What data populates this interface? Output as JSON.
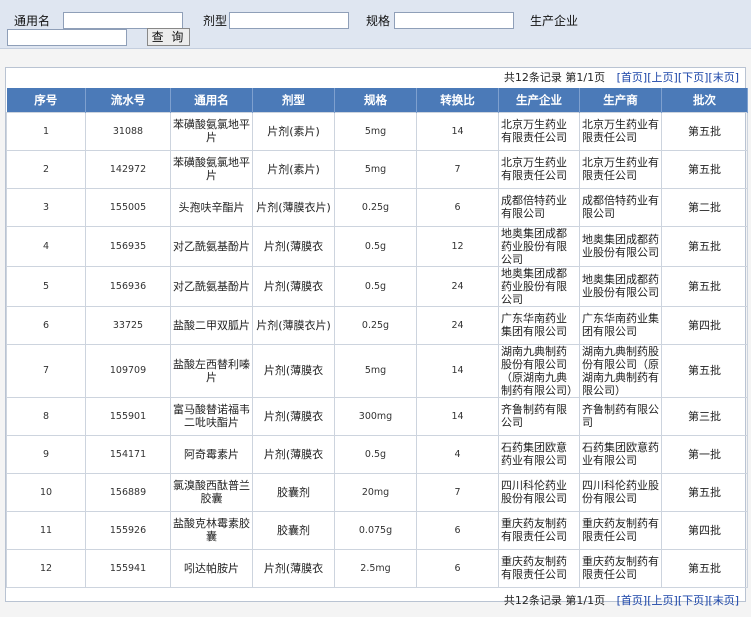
{
  "search": {
    "generic_name_label": "通用名",
    "dosage_form_label": "剂型",
    "spec_label": "规格",
    "manufacturer_label": "生产企业",
    "query_button": "查 询"
  },
  "pager": {
    "summary": "共12条记录 第1/1页",
    "first": "[首页]",
    "prev": "[上页]",
    "next": "[下页]",
    "last": "[末页]"
  },
  "table": {
    "headers": [
      "序号",
      "流水号",
      "通用名",
      "剂型",
      "规格",
      "转换比",
      "生产企业",
      "生产商",
      "批次"
    ],
    "rows": [
      {
        "no": "1",
        "serial": "31088",
        "name": "苯磺酸氨氯地平片",
        "form": "片剂(素片)",
        "spec": "5mg",
        "ratio": "14",
        "company": "北京万生药业有限责任公司",
        "maker": "北京万生药业有限责任公司",
        "batch": "第五批"
      },
      {
        "no": "2",
        "serial": "142972",
        "name": "苯磺酸氨氯地平片",
        "form": "片剂(素片)",
        "spec": "5mg",
        "ratio": "7",
        "company": "北京万生药业有限责任公司",
        "maker": "北京万生药业有限责任公司",
        "batch": "第五批"
      },
      {
        "no": "3",
        "serial": "155005",
        "name": "头孢呋辛酯片",
        "form": "片剂(薄膜衣片)",
        "spec": "0.25g",
        "ratio": "6",
        "company": "成都倍特药业有限公司",
        "maker": "成都倍特药业有限公司",
        "batch": "第二批"
      },
      {
        "no": "4",
        "serial": "156935",
        "name": "对乙酰氨基酚片",
        "form": "片剂(薄膜衣",
        "spec": "0.5g",
        "ratio": "12",
        "company": "地奥集团成都药业股份有限公司",
        "maker": "地奥集团成都药业股份有限公司",
        "batch": "第五批"
      },
      {
        "no": "5",
        "serial": "156936",
        "name": "对乙酰氨基酚片",
        "form": "片剂(薄膜衣",
        "spec": "0.5g",
        "ratio": "24",
        "company": "地奥集团成都药业股份有限公司",
        "maker": "地奥集团成都药业股份有限公司",
        "batch": "第五批"
      },
      {
        "no": "6",
        "serial": "33725",
        "name": "盐酸二甲双胍片",
        "form": "片剂(薄膜衣片)",
        "spec": "0.25g",
        "ratio": "24",
        "company": "广东华南药业集团有限公司",
        "maker": "广东华南药业集团有限公司",
        "batch": "第四批"
      },
      {
        "no": "7",
        "serial": "109709",
        "name": "盐酸左西替利嗪片",
        "form": "片剂(薄膜衣",
        "spec": "5mg",
        "ratio": "14",
        "company": "湖南九典制药股份有限公司（原湖南九典制药有限公司）",
        "maker": "湖南九典制药股份有限公司（原湖南九典制药有限公司）",
        "batch": "第五批"
      },
      {
        "no": "8",
        "serial": "155901",
        "name": "富马酸替诺福韦二吡呋酯片",
        "form": "片剂(薄膜衣",
        "spec": "300mg",
        "ratio": "14",
        "company": "齐鲁制药有限公司",
        "maker": "齐鲁制药有限公司",
        "batch": "第三批"
      },
      {
        "no": "9",
        "serial": "154171",
        "name": "阿奇霉素片",
        "form": "片剂(薄膜衣",
        "spec": "0.5g",
        "ratio": "4",
        "company": "石药集团欧意药业有限公司",
        "maker": "石药集团欧意药业有限公司",
        "batch": "第一批"
      },
      {
        "no": "10",
        "serial": "156889",
        "name": "氯溴酸西酞普兰胶囊",
        "form": "胶囊剂",
        "spec": "20mg",
        "ratio": "7",
        "company": "四川科伦药业股份有限公司",
        "maker": "四川科伦药业股份有限公司",
        "batch": "第五批"
      },
      {
        "no": "11",
        "serial": "155926",
        "name": "盐酸克林霉素胶囊",
        "form": "胶囊剂",
        "spec": "0.075g",
        "ratio": "6",
        "company": "重庆药友制药有限责任公司",
        "maker": "重庆药友制药有限责任公司",
        "batch": "第四批"
      },
      {
        "no": "12",
        "serial": "155941",
        "name": "吲达帕胺片",
        "form": "片剂(薄膜衣",
        "spec": "2.5mg",
        "ratio": "6",
        "company": "重庆药友制药有限责任公司",
        "maker": "重庆药友制药有限责任公司",
        "batch": "第五批"
      }
    ]
  }
}
